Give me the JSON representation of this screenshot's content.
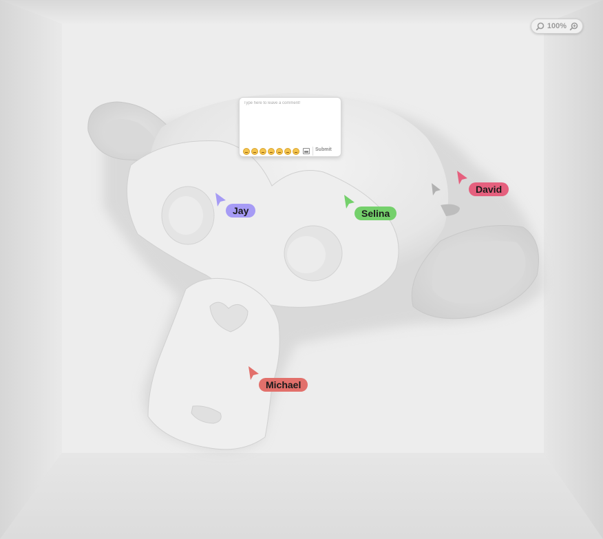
{
  "viewport": {
    "zoom_label": "100%",
    "zoom_out_icon": "zoom-out-icon",
    "zoom_in_icon": "zoom-in-icon"
  },
  "comment": {
    "placeholder": "Type here to leave a comment!",
    "value": "",
    "emojis": [
      "neutral-face",
      "smiling-face",
      "grinning-face",
      "beaming-face",
      "sunglasses-face",
      "heart-eyes-face",
      "starstruck-face"
    ],
    "image_icon": "image-icon",
    "submit_label": "Submit"
  },
  "collaborators": [
    {
      "name": "Jay",
      "color": "#a69bf5"
    },
    {
      "name": "Selina",
      "color": "#74d06b"
    },
    {
      "name": "David",
      "color": "#e5607e"
    },
    {
      "name": "Michael",
      "color": "#e2706b"
    }
  ]
}
